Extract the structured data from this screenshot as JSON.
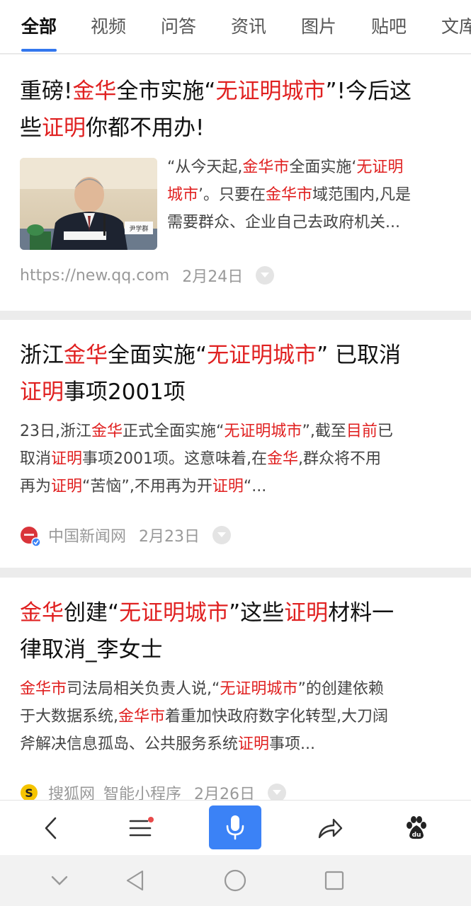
{
  "tabs": [
    "全部",
    "视频",
    "问答",
    "资讯",
    "图片",
    "贴吧",
    "文库"
  ],
  "results": [
    {
      "title": [
        {
          "t": "重磅!"
        },
        {
          "t": "金华",
          "h": true
        },
        {
          "t": "全市实施“"
        },
        {
          "t": "无证明城市",
          "h": true
        },
        {
          "t": "”!今后这"
        },
        {
          "br": true
        },
        {
          "t": "些"
        },
        {
          "t": "证明",
          "h": true
        },
        {
          "t": "你都不用办!"
        }
      ],
      "snippet": [
        {
          "t": "“从今天起,"
        },
        {
          "t": "金华市",
          "h": true
        },
        {
          "t": "全面实施‘"
        },
        {
          "t": "无证明",
          "h": true
        },
        {
          "br": true
        },
        {
          "t": "城市",
          "h": true
        },
        {
          "t": "’。只要在"
        },
        {
          "t": "金华市",
          "h": true
        },
        {
          "t": "域范围内,凡是"
        },
        {
          "br": true
        },
        {
          "t": "需要群众、企业自己去政府机关..."
        }
      ],
      "thumbnail_caption": "尹学群",
      "source": "https://new.qq.com",
      "date": "2月24日"
    },
    {
      "title": [
        {
          "t": "浙江"
        },
        {
          "t": "金华",
          "h": true
        },
        {
          "t": "全面实施“"
        },
        {
          "t": "无证明城市",
          "h": true
        },
        {
          "t": "” 已取消"
        },
        {
          "br": true
        },
        {
          "t": "证明",
          "h": true
        },
        {
          "t": "事项2001项"
        }
      ],
      "snippet": [
        {
          "t": "23日,浙江"
        },
        {
          "t": "金华",
          "h": true
        },
        {
          "t": "正式全面实施“"
        },
        {
          "t": "无证明城市",
          "h": true
        },
        {
          "t": "”,截至"
        },
        {
          "t": "目前",
          "h": true
        },
        {
          "t": "已"
        },
        {
          "br": true
        },
        {
          "t": "取消"
        },
        {
          "t": "证明",
          "h": true
        },
        {
          "t": "事项2001项。这意味着,在"
        },
        {
          "t": "金华",
          "h": true
        },
        {
          "t": ",群众将不用"
        },
        {
          "br": true
        },
        {
          "t": "再为"
        },
        {
          "t": "证明",
          "h": true
        },
        {
          "t": "“苦恼”,不用再为开"
        },
        {
          "t": "证明",
          "h": true
        },
        {
          "t": "“..."
        }
      ],
      "source": "中国新闻网",
      "date": "2月23日"
    },
    {
      "title": [
        {
          "t": "金华",
          "h": true
        },
        {
          "t": "创建“"
        },
        {
          "t": "无证明城市",
          "h": true
        },
        {
          "t": "”这些"
        },
        {
          "t": "证明",
          "h": true
        },
        {
          "t": "材料一"
        },
        {
          "br": true
        },
        {
          "t": "律取消_李女士"
        }
      ],
      "snippet": [
        {
          "t": "金华市",
          "h": true
        },
        {
          "t": "司法局相关负责人说,“"
        },
        {
          "t": "无证明城市",
          "h": true
        },
        {
          "t": "”的创建依赖"
        },
        {
          "br": true
        },
        {
          "t": "于大数据系统,"
        },
        {
          "t": "金华市",
          "h": true
        },
        {
          "t": "着重加快政府数字化转型,大刀阔"
        },
        {
          "br": true
        },
        {
          "t": "斧解决信息孤岛、公共服务系统"
        },
        {
          "t": "证明",
          "h": true
        },
        {
          "t": "事项..."
        }
      ],
      "source": "搜狐网",
      "source_sub": "智能小程序",
      "date": "2月26日"
    }
  ],
  "colors": {
    "highlight": "#e02020",
    "accent": "#3b82f6"
  },
  "icons": [
    "back-icon",
    "menu-icon",
    "microphone-icon",
    "share-icon",
    "baidu-paw-icon",
    "chevron-down-icon",
    "triangle-back-icon",
    "circle-home-icon",
    "square-recent-icon"
  ]
}
